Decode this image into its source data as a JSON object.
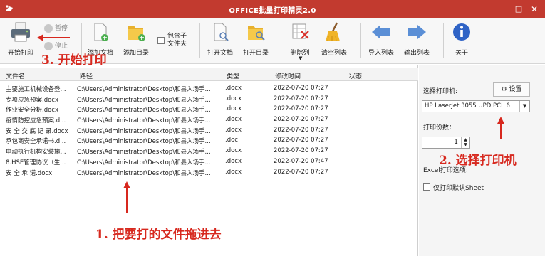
{
  "window": {
    "title": "OFFICE批量打印精灵2.0",
    "minimize": "_",
    "maximize": "□",
    "close": "✕"
  },
  "toolbar": {
    "start_print": "开始打印",
    "pause": "暂停",
    "stop": "停止",
    "add_doc": "添加文档",
    "add_dir": "添加目录",
    "include_subfolder": "包含子文件夹",
    "open_doc": "打开文档",
    "open_dir": "打开目录",
    "delete_col": "删除列",
    "clear_list": "清空列表",
    "import_list": "导入列表",
    "export_list": "输出列表",
    "about": "关于"
  },
  "list": {
    "headers": [
      "文件名",
      "路径",
      "类型",
      "修改时间",
      "状态"
    ],
    "rows": [
      {
        "name": "主要施工机械设备登...",
        "path": "C:\\Users\\Administrator\\Desktop\\和县入场手...",
        "type": ".docx",
        "date": "2022-07-20 07:27",
        "status": ""
      },
      {
        "name": "专项应急预案.docx",
        "path": "C:\\Users\\Administrator\\Desktop\\和县入场手...",
        "type": ".docx",
        "date": "2022-07-20 07:27",
        "status": ""
      },
      {
        "name": "作业安全分析.docx",
        "path": "C:\\Users\\Administrator\\Desktop\\和县入场手...",
        "type": ".docx",
        "date": "2022-07-20 07:27",
        "status": ""
      },
      {
        "name": "疫情防控应急预案.d...",
        "path": "C:\\Users\\Administrator\\Desktop\\和县入场手...",
        "type": ".docx",
        "date": "2022-07-20 07:27",
        "status": ""
      },
      {
        "name": "安 全 交 底 记 录.docx",
        "path": "C:\\Users\\Administrator\\Desktop\\和县入场手...",
        "type": ".docx",
        "date": "2022-07-20 07:27",
        "status": ""
      },
      {
        "name": "承包商安全承诺书.d...",
        "path": "C:\\Users\\Administrator\\Desktop\\和县入场手...",
        "type": ".doc",
        "date": "2022-07-20 07:27",
        "status": ""
      },
      {
        "name": "电动执行机构安装施...",
        "path": "C:\\Users\\Administrator\\Desktop\\和县入场手...",
        "type": ".docx",
        "date": "2022-07-20 07:27",
        "status": ""
      },
      {
        "name": "8.HSE管理协议（生...",
        "path": "C:\\Users\\Administrator\\Desktop\\和县入场手...",
        "type": ".docx",
        "date": "2022-07-20 07:47",
        "status": ""
      },
      {
        "name": "安 全 承 诺.docx",
        "path": "C:\\Users\\Administrator\\Desktop\\和县入场手...",
        "type": ".docx",
        "date": "2022-07-20 07:27",
        "status": ""
      }
    ]
  },
  "panel": {
    "select_printer_label": "选择打印机:",
    "settings_button": "设置",
    "printer_value": "HP LaserJet 3055 UPD PCL 6",
    "copies_label": "打印份数：",
    "copies_value": "1",
    "excel_options_label": "Excel打印选项:",
    "print_default_sheet": "仅打印默认Sheet"
  },
  "annotations": {
    "step1": "1. 把要打的文件拖进去",
    "step2": "2. 选择打印机",
    "step3": "3. 开始打印"
  },
  "colors": {
    "title_bar": "#c23a2f",
    "annotation": "#d7281e"
  }
}
